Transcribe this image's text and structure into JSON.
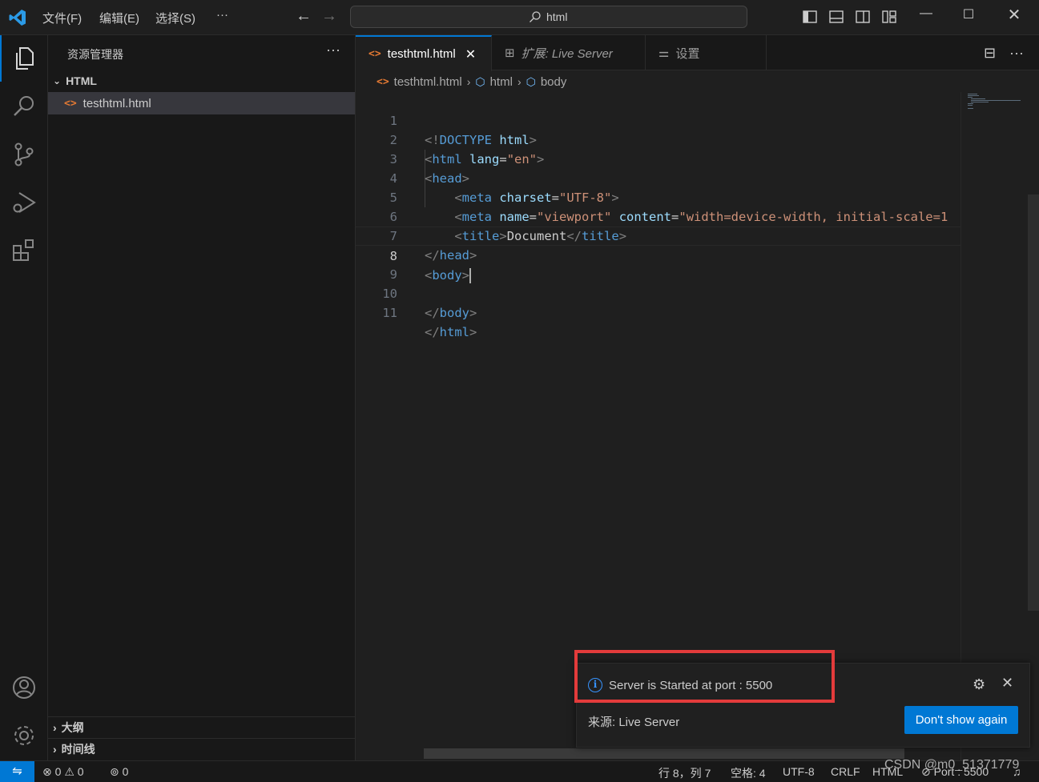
{
  "titlebar": {
    "menus": [
      "文件(F)",
      "编辑(E)",
      "选择(S)",
      "···"
    ],
    "search": "html",
    "window_controls": [
      "minimize-icon",
      "maximize-icon",
      "close-icon"
    ]
  },
  "activity_bar": {
    "items": [
      "explorer-icon",
      "search-icon",
      "source-control-icon",
      "run-debug-icon",
      "extensions-icon"
    ],
    "bottom": [
      "account-icon",
      "manage-gear-icon"
    ]
  },
  "sidebar": {
    "title": "资源管理器",
    "more": "···",
    "folder": "HTML",
    "file": "testhtml.html",
    "sections": [
      "大纲",
      "时间线"
    ]
  },
  "tabs": [
    {
      "label": "testhtml.html",
      "active": true
    },
    {
      "label": "扩展: Live Server",
      "active": false
    },
    {
      "label": "设置",
      "active": false
    }
  ],
  "breadcrumb": [
    "testhtml.html",
    "html",
    "body"
  ],
  "editor": {
    "line_numbers": [
      "1",
      "2",
      "3",
      "4",
      "5",
      "6",
      "7",
      "8",
      "9",
      "10",
      "11"
    ],
    "current_line": "8",
    "lines": [
      "<!DOCTYPE html>",
      "<html lang=\"en\">",
      "<head>",
      "    <meta charset=\"UTF-8\">",
      "    <meta name=\"viewport\" content=\"width=device-width, initial-scale=1",
      "    <title>Document</title>",
      "</head>",
      "<body>",
      "",
      "</body>",
      "</html>"
    ]
  },
  "notification": {
    "message": "Server is Started at port : 5500",
    "source": "来源: Live Server",
    "button": "Don't show again"
  },
  "statusbar": {
    "errors": "0",
    "warnings": "0",
    "ports": "0",
    "position": "行 8，列 7",
    "spaces": "空格: 4",
    "encoding": "UTF-8",
    "eol": "CRLF",
    "language": "HTML",
    "port": "Port : 5500"
  },
  "watermark": "CSDN @m0_51371779",
  "colors": {
    "accent": "#0078d4",
    "highlight_box": "#e33b3b",
    "tag": "#569cd6",
    "attr": "#9cdcfe",
    "string": "#ce9178"
  }
}
